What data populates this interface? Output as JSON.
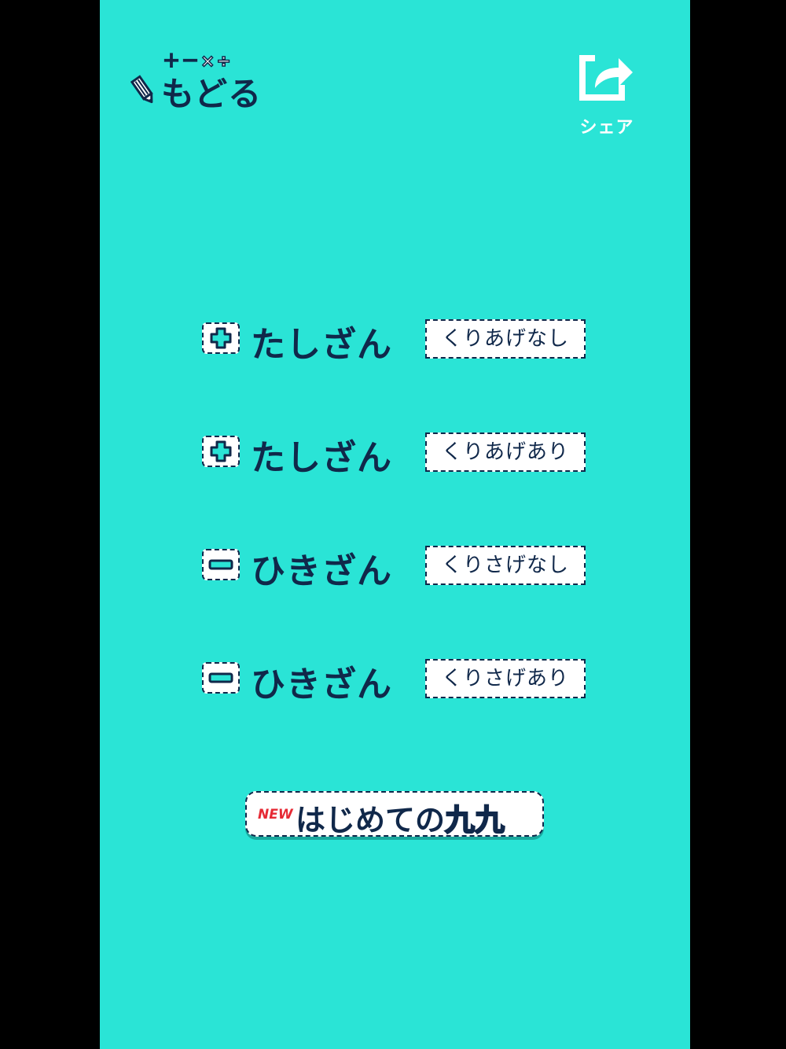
{
  "header": {
    "back_ops": "＋－×÷",
    "back_label": "もどる",
    "share_label": "シェア"
  },
  "menu": [
    {
      "symbol": "plus-icon",
      "title": "たしざん",
      "tag": "くりあげなし"
    },
    {
      "symbol": "plus-icon",
      "title": "たしざん",
      "tag": "くりあげあり"
    },
    {
      "symbol": "minus-icon",
      "title": "ひきざん",
      "tag": "くりさげなし"
    },
    {
      "symbol": "minus-icon",
      "title": "ひきざん",
      "tag": "くりさげあり"
    }
  ],
  "promo": {
    "new_badge": "NEW",
    "label": "はじめての",
    "accent": "九九"
  },
  "colors": {
    "background": "#2ae4d6",
    "navy": "#10284a",
    "new_badge": "#e62a35",
    "white": "#ffffff"
  }
}
